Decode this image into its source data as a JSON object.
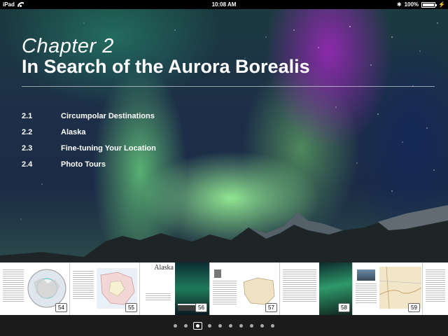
{
  "status_bar": {
    "device": "iPad",
    "time": "10:08 AM",
    "battery": "100%",
    "battery_level": 1.0
  },
  "chapter": {
    "label": "Chapter 2",
    "title": "In Search of the Aurora Borealis"
  },
  "toc": [
    {
      "number": "2.1",
      "title": "Circumpolar Destinations"
    },
    {
      "number": "2.2",
      "title": "Alaska"
    },
    {
      "number": "2.3",
      "title": "Fine-tuning Your Location"
    },
    {
      "number": "2.4",
      "title": "Photo Tours"
    }
  ],
  "thumbnails": {
    "page_numbers": [
      "54",
      "55",
      "56",
      "57",
      "58",
      "59"
    ],
    "heading": "Alaska"
  },
  "pager": {
    "dot_count": 10,
    "active_index": 2
  },
  "colors": {
    "accent_white": "#ffffff",
    "strip_background": "#e8e8e8",
    "pager_background": "#1c1c1c"
  },
  "icons": [
    "wifi-icon",
    "bluetooth-icon",
    "battery-icon",
    "charging-icon"
  ]
}
